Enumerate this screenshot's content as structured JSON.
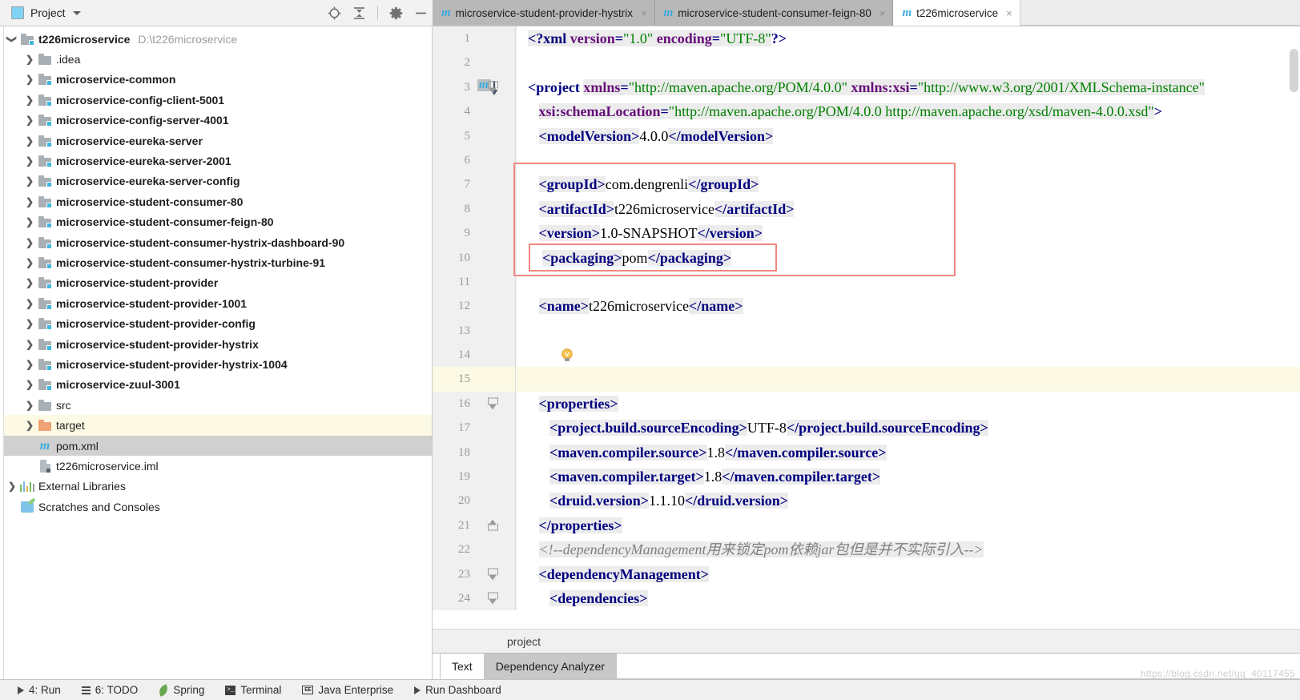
{
  "project_panel": {
    "title": "Project",
    "icon": "project-window-icon",
    "dropdown_icon": "chevron-down-icon",
    "toolbar_icons": [
      "locate-icon",
      "collapse-all-icon",
      "gear-icon",
      "hide-icon"
    ],
    "tree": [
      {
        "label": "t226microservice",
        "path": "D:\\t226microservice",
        "indent": 0,
        "arrow": "expanded",
        "icon": "module-folder-icon",
        "bold": true
      },
      {
        "label": ".idea",
        "indent": 1,
        "arrow": "collapsed",
        "icon": "folder-icon",
        "bold": false
      },
      {
        "label": "microservice-common",
        "indent": 1,
        "arrow": "collapsed",
        "icon": "module-folder-icon",
        "bold": true
      },
      {
        "label": "microservice-config-client-5001",
        "indent": 1,
        "arrow": "collapsed",
        "icon": "module-folder-icon",
        "bold": true
      },
      {
        "label": "microservice-config-server-4001",
        "indent": 1,
        "arrow": "collapsed",
        "icon": "module-folder-icon",
        "bold": true
      },
      {
        "label": "microservice-eureka-server",
        "indent": 1,
        "arrow": "collapsed",
        "icon": "module-folder-icon",
        "bold": true
      },
      {
        "label": "microservice-eureka-server-2001",
        "indent": 1,
        "arrow": "collapsed",
        "icon": "module-folder-icon",
        "bold": true
      },
      {
        "label": "microservice-eureka-server-config",
        "indent": 1,
        "arrow": "collapsed",
        "icon": "module-folder-icon",
        "bold": true
      },
      {
        "label": "microservice-student-consumer-80",
        "indent": 1,
        "arrow": "collapsed",
        "icon": "module-folder-icon",
        "bold": true
      },
      {
        "label": "microservice-student-consumer-feign-80",
        "indent": 1,
        "arrow": "collapsed",
        "icon": "module-folder-icon",
        "bold": true
      },
      {
        "label": "microservice-student-consumer-hystrix-dashboard-90",
        "indent": 1,
        "arrow": "collapsed",
        "icon": "module-folder-icon",
        "bold": true
      },
      {
        "label": "microservice-student-consumer-hystrix-turbine-91",
        "indent": 1,
        "arrow": "collapsed",
        "icon": "module-folder-icon",
        "bold": true
      },
      {
        "label": "microservice-student-provider",
        "indent": 1,
        "arrow": "collapsed",
        "icon": "module-folder-icon",
        "bold": true
      },
      {
        "label": "microservice-student-provider-1001",
        "indent": 1,
        "arrow": "collapsed",
        "icon": "module-folder-icon",
        "bold": true
      },
      {
        "label": "microservice-student-provider-config",
        "indent": 1,
        "arrow": "collapsed",
        "icon": "module-folder-icon",
        "bold": true
      },
      {
        "label": "microservice-student-provider-hystrix",
        "indent": 1,
        "arrow": "collapsed",
        "icon": "module-folder-icon",
        "bold": true
      },
      {
        "label": "microservice-student-provider-hystrix-1004",
        "indent": 1,
        "arrow": "collapsed",
        "icon": "module-folder-icon",
        "bold": true
      },
      {
        "label": "microservice-zuul-3001",
        "indent": 1,
        "arrow": "collapsed",
        "icon": "module-folder-icon",
        "bold": true
      },
      {
        "label": "src",
        "indent": 1,
        "arrow": "collapsed",
        "icon": "folder-icon",
        "bold": false
      },
      {
        "label": "target",
        "indent": 1,
        "arrow": "collapsed",
        "icon": "target-folder-icon",
        "bold": false,
        "state": "yellow"
      },
      {
        "label": "pom.xml",
        "indent": 1,
        "arrow": "none",
        "icon": "maven-file-icon",
        "bold": false,
        "state": "selected"
      },
      {
        "label": "t226microservice.iml",
        "indent": 1,
        "arrow": "none",
        "icon": "iml-file-icon",
        "bold": false
      },
      {
        "label": "External Libraries",
        "indent": 0,
        "arrow": "collapsed",
        "icon": "external-libraries-icon",
        "bold": false
      },
      {
        "label": "Scratches and Consoles",
        "indent": 0,
        "arrow": "none",
        "icon": "scratches-icon",
        "bold": false
      }
    ]
  },
  "editor": {
    "tabs": [
      {
        "label": "microservice-student-provider-hystrix",
        "icon": "maven-file-icon",
        "close": "×",
        "active": false
      },
      {
        "label": "microservice-student-consumer-feign-80",
        "icon": "maven-file-icon",
        "close": "×",
        "active": false
      },
      {
        "label": "t226microservice",
        "icon": "maven-file-icon",
        "close": "×",
        "active": true
      }
    ],
    "breadcrumb": "project",
    "bottom_tabs": [
      {
        "label": "Text",
        "active": true
      },
      {
        "label": "Dependency Analyzer",
        "active": false
      }
    ],
    "lines": [
      {
        "n": "1",
        "fold": "none",
        "html": "<span class=\"tk pi\">&lt;?xml </span><span class=\"tk attr\">version</span><span class=\"tk tag\">=</span><span class=\"tk str\">\"1.0\"</span><span class=\"tk\"> </span><span class=\"tk attr\">encoding</span><span class=\"tk tag\">=</span><span class=\"tk str\">\"UTF-8\"</span><span class=\"pi\">?&gt;</span>"
      },
      {
        "n": "2",
        "fold": "none",
        "html": ""
      },
      {
        "n": "3",
        "fold": "open",
        "gutter": "maven",
        "html": "<span class=\"tag\">&lt;project </span><span class=\"tk attr\">xmlns</span><span class=\"tk tag\">=</span><span class=\"tk str\">\"http://maven.apache.org/POM/4.0.0\"</span><span class=\"tk\"> </span><span class=\"tk attr\">xmlns:xsi</span><span class=\"tk tag\">=</span><span class=\"tk str\">\"http://www.w3.org/2001/XMLSchema-instance\"</span>"
      },
      {
        "n": "4",
        "fold": "none",
        "html": "   <span class=\"tk attr\">xsi:schemaLocation</span><span class=\"tk tag\">=</span><span class=\"tk str\">\"http://maven.apache.org/POM/4.0.0 http://maven.apache.org/xsd/maven-4.0.0.xsd\"</span><span class=\"tag\">&gt;</span>"
      },
      {
        "n": "5",
        "fold": "none",
        "html": "   <span class=\"tk tag\">&lt;modelVersion&gt;</span><span class=\"val\">4.0.0</span><span class=\"tk tag\">&lt;/modelVersion&gt;</span>"
      },
      {
        "n": "6",
        "fold": "none",
        "html": ""
      },
      {
        "n": "7",
        "fold": "none",
        "html": "   <span class=\"tk tag\">&lt;groupId&gt;</span><span class=\"val\">com.dengrenli</span><span class=\"tk tag\">&lt;/groupId&gt;</span>"
      },
      {
        "n": "8",
        "fold": "none",
        "html": "   <span class=\"tk tag\">&lt;artifactId&gt;</span><span class=\"val\">t226microservice</span><span class=\"tk tag\">&lt;/artifactId&gt;</span>"
      },
      {
        "n": "9",
        "fold": "none",
        "html": "   <span class=\"tk tag\">&lt;version&gt;</span><span class=\"val\">1.0-SNAPSHOT</span><span class=\"tk tag\">&lt;/version&gt;</span>"
      },
      {
        "n": "10",
        "fold": "none",
        "html": "    <span class=\"tk tag\">&lt;packaging&gt;</span><span class=\"val\">pom</span><span class=\"tk tag\">&lt;/packaging&gt;</span>"
      },
      {
        "n": "11",
        "fold": "none",
        "html": ""
      },
      {
        "n": "12",
        "fold": "none",
        "html": "   <span class=\"tk tag\">&lt;name&gt;</span><span class=\"val\">t226microservice</span><span class=\"tk tag\">&lt;/name&gt;</span>"
      },
      {
        "n": "13",
        "fold": "none",
        "html": ""
      },
      {
        "n": "14",
        "fold": "none",
        "gutter": "bulb",
        "html": ""
      },
      {
        "n": "15",
        "fold": "none",
        "highlight": true,
        "html": ""
      },
      {
        "n": "16",
        "fold": "open",
        "html": "   <span class=\"tk tag\">&lt;properties&gt;</span>"
      },
      {
        "n": "17",
        "fold": "none",
        "html": "      <span class=\"tk tag\">&lt;project.build.sourceEncoding&gt;</span><span class=\"val\">UTF-8</span><span class=\"tk tag\">&lt;/project.build.sourceEncoding&gt;</span>"
      },
      {
        "n": "18",
        "fold": "none",
        "html": "      <span class=\"tk tag\">&lt;maven.compiler.source&gt;</span><span class=\"val\">1.8</span><span class=\"tk tag\">&lt;/maven.compiler.source&gt;</span>"
      },
      {
        "n": "19",
        "fold": "none",
        "html": "      <span class=\"tk tag\">&lt;maven.compiler.target&gt;</span><span class=\"val\">1.8</span><span class=\"tk tag\">&lt;/maven.compiler.target&gt;</span>"
      },
      {
        "n": "20",
        "fold": "none",
        "html": "      <span class=\"tk tag\">&lt;druid.version&gt;</span><span class=\"val\">1.1.10</span><span class=\"tk tag\">&lt;/druid.version&gt;</span>"
      },
      {
        "n": "21",
        "fold": "close",
        "html": "   <span class=\"tk tag\">&lt;/properties&gt;</span>"
      },
      {
        "n": "22",
        "fold": "none",
        "html": "   <span class=\"tk cmt\">&lt;!--dependencyManagement用来锁定pom依赖jar包但是并不实际引入--&gt;</span>"
      },
      {
        "n": "23",
        "fold": "open",
        "html": "   <span class=\"tk tag\">&lt;dependencyManagement&gt;</span>"
      },
      {
        "n": "24",
        "fold": "open",
        "html": "      <span class=\"tk tag\">&lt;dependencies&gt;</span>"
      }
    ],
    "annotations": {
      "outer_box_label": "highlight-box-coordinates",
      "inner_box_label": "highlight-box-packaging",
      "box_color": "#f2877f"
    }
  },
  "statusbar": {
    "items": [
      {
        "label": "4: Run",
        "icon": "run-icon"
      },
      {
        "label": "6: TODO",
        "icon": "todo-icon"
      },
      {
        "label": "Spring",
        "icon": "spring-leaf-icon"
      },
      {
        "label": "Terminal",
        "icon": "terminal-icon"
      },
      {
        "label": "Java Enterprise",
        "icon": "java-enterprise-icon"
      },
      {
        "label": "Run Dashboard",
        "icon": "run-icon"
      }
    ]
  },
  "watermark": "https://blog.csdn.net/qq_40117455"
}
